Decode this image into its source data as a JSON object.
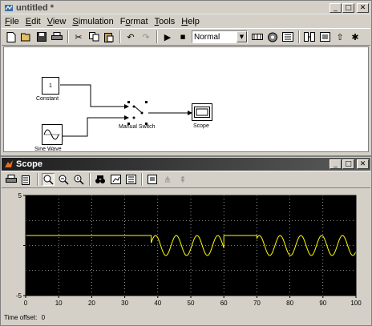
{
  "model_window": {
    "title": "untitled *",
    "menus": [
      "File",
      "Edit",
      "View",
      "Simulation",
      "Format",
      "Tools",
      "Help"
    ],
    "menu_underline": [
      "F",
      "E",
      "V",
      "S",
      "o",
      "T",
      "H"
    ],
    "mode_select": "Normal",
    "blocks": {
      "constant": {
        "value": "1",
        "label": "Constant"
      },
      "sine": {
        "label": "Sine Wave"
      },
      "switch": {
        "label": "Manual Switch"
      },
      "scope": {
        "label": "Scope"
      }
    }
  },
  "scope_window": {
    "title": "Scope",
    "time_offset_label": "Time offset:",
    "time_offset_value": "0"
  },
  "chart_data": {
    "type": "line",
    "title": "",
    "xlabel": "",
    "ylabel": "",
    "xlim": [
      0,
      100
    ],
    "ylim": [
      -5,
      5
    ],
    "x_ticks": [
      "0",
      "10",
      "20",
      "30",
      "40",
      "50",
      "60",
      "70",
      "80",
      "90",
      "100"
    ],
    "y_ticks": [
      "5",
      "",
      "-5"
    ],
    "grid": true,
    "background": "#000000",
    "line_color": "#ffff00",
    "series": [
      {
        "segments": [
          {
            "kind": "constant",
            "x": [
              0,
              38
            ],
            "value": 1
          },
          {
            "kind": "sine",
            "x": [
              38,
              60
            ],
            "amplitude": 1,
            "frequency": 0.159
          },
          {
            "kind": "constant",
            "x": [
              60,
              70
            ],
            "value": 1
          },
          {
            "kind": "sine",
            "x": [
              70,
              100
            ],
            "amplitude": 1,
            "frequency": 0.159
          }
        ]
      }
    ]
  }
}
